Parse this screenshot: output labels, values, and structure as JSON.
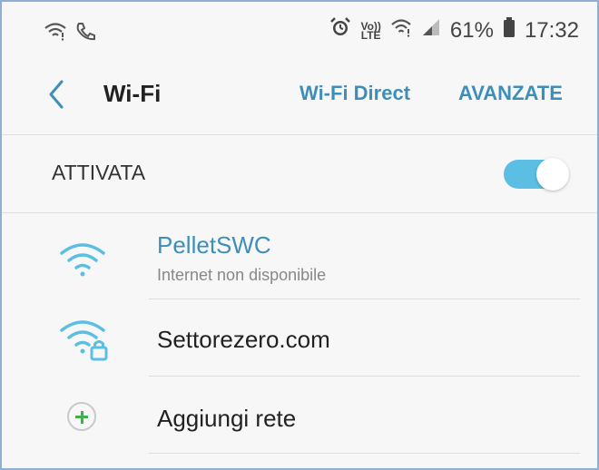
{
  "status_bar": {
    "left_icons": [
      "wifi-icon",
      "phone-call-icon"
    ],
    "right_icons": [
      "alarm-icon",
      "volte-icon",
      "wifi-icon",
      "signal-icon",
      "battery-icon"
    ],
    "volte_label_top": "Vo))",
    "volte_label_bottom": "LTE",
    "battery_percent": "61%",
    "time": "17:32"
  },
  "app_bar": {
    "back_icon": "chevron-left-icon",
    "title": "Wi-Fi",
    "actions": [
      "Wi-Fi Direct",
      "AVANZATE"
    ]
  },
  "toggle": {
    "label": "ATTIVATA",
    "state": true,
    "accent_color": "#5bbfe3"
  },
  "networks": [
    {
      "name": "PelletSWC",
      "status": "Internet non disponibile",
      "icon": "wifi-icon",
      "connected": true
    },
    {
      "name": "Settorezero.com",
      "status": "",
      "icon": "wifi-lock-icon",
      "connected": false
    }
  ],
  "add_network": {
    "label": "Aggiungi rete",
    "icon": "plus-icon"
  },
  "colors": {
    "link": "#3d8fb8",
    "plus": "#3cb34a",
    "background": "#f7f7f7"
  }
}
